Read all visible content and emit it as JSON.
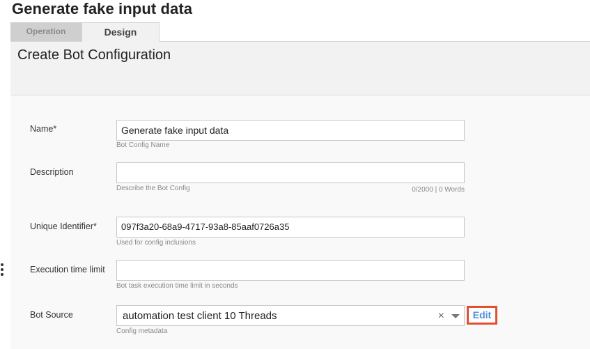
{
  "page": {
    "title": "Generate fake input data"
  },
  "tabs": [
    {
      "label": "Operation",
      "active": false
    },
    {
      "label": "Design",
      "active": true
    }
  ],
  "section": {
    "title": "Create Bot Configuration"
  },
  "form": {
    "name": {
      "label": "Name*",
      "value": "Generate fake input data",
      "hint": "Bot Config Name"
    },
    "description": {
      "label": "Description",
      "value": "",
      "hint": "Describe the Bot Config",
      "counter": "0/2000 | 0 Words"
    },
    "unique_id": {
      "label": "Unique Identifier*",
      "value": "097f3a20-68a9-4717-93a8-85aaf0726a35",
      "hint": "Used for config inclusions"
    },
    "exec_limit": {
      "label": "Execution time limit",
      "value": "",
      "hint": "Bot task execution time limit in seconds"
    },
    "bot_source": {
      "label": "Bot Source",
      "value": "automation test client 10 Threads",
      "hint": "Config metadata",
      "clear_glyph": "×",
      "edit_label": "Edit"
    }
  },
  "colors": {
    "edit_highlight": "#e4502f",
    "link": "#4a90d9"
  }
}
